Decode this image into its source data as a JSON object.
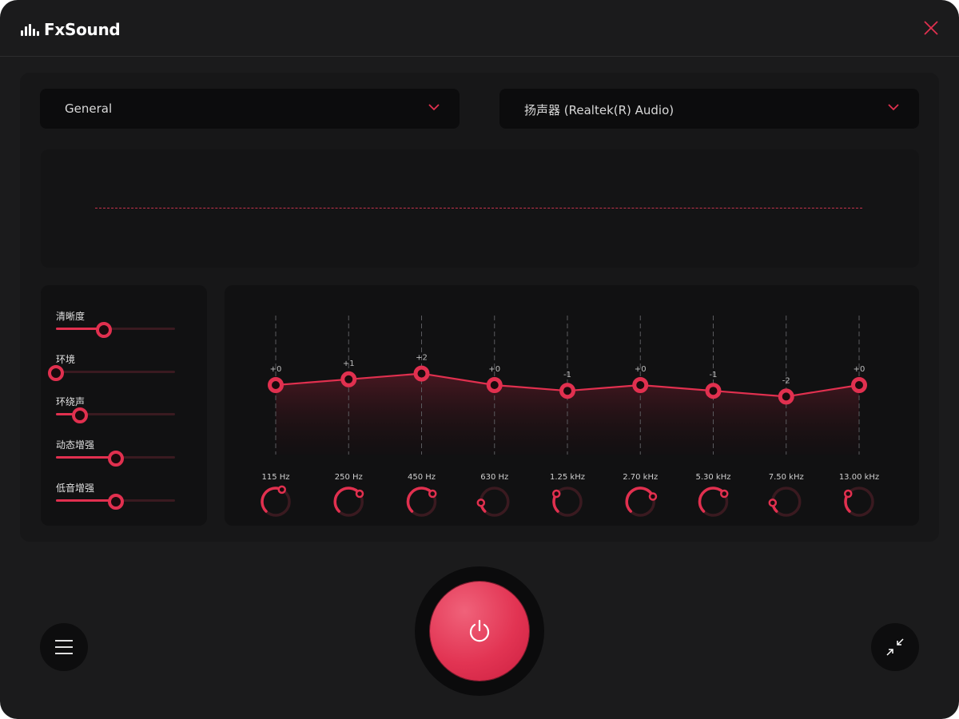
{
  "app": {
    "title": "FxSound",
    "accent_color": "#e1304f"
  },
  "icons": {
    "logo": "bars-logo-icon",
    "close": "close-icon",
    "dropdown": "chevron-down-icon",
    "menu": "hamburger-menu-icon",
    "minimize": "collapse-arrows-icon",
    "power": "power-icon"
  },
  "preset_dropdown": {
    "selected": "General"
  },
  "device_dropdown": {
    "selected": "扬声器 (Realtek(R) Audio)"
  },
  "effects": [
    {
      "label": "清晰度",
      "value": 0.4
    },
    {
      "label": "环境",
      "value": 0.0
    },
    {
      "label": "环绕声",
      "value": 0.2
    },
    {
      "label": "动态增强",
      "value": 0.5
    },
    {
      "label": "低音增强",
      "value": 0.5
    }
  ],
  "equalizer": {
    "min_gain": -12,
    "max_gain": 12,
    "bands": [
      {
        "freq": "115 Hz",
        "gain": 0,
        "gain_label": "+0"
      },
      {
        "freq": "250 Hz",
        "gain": 1,
        "gain_label": "+1"
      },
      {
        "freq": "450 Hz",
        "gain": 2,
        "gain_label": "+2"
      },
      {
        "freq": "630 Hz",
        "gain": 0,
        "gain_label": "+0"
      },
      {
        "freq": "1.25 kHz",
        "gain": -1,
        "gain_label": "-1"
      },
      {
        "freq": "2.70 kHz",
        "gain": 0,
        "gain_label": "+0"
      },
      {
        "freq": "5.30 kHz",
        "gain": -1,
        "gain_label": "-1"
      },
      {
        "freq": "7.50 kHz",
        "gain": -2,
        "gain_label": "-2"
      },
      {
        "freq": "13.00 kHz",
        "gain": 0,
        "gain_label": "+0"
      }
    ],
    "knob_levels": [
      0.6,
      0.7,
      0.7,
      0.15,
      0.3,
      0.75,
      0.7,
      0.15,
      0.3
    ]
  },
  "power": {
    "state": "on"
  }
}
